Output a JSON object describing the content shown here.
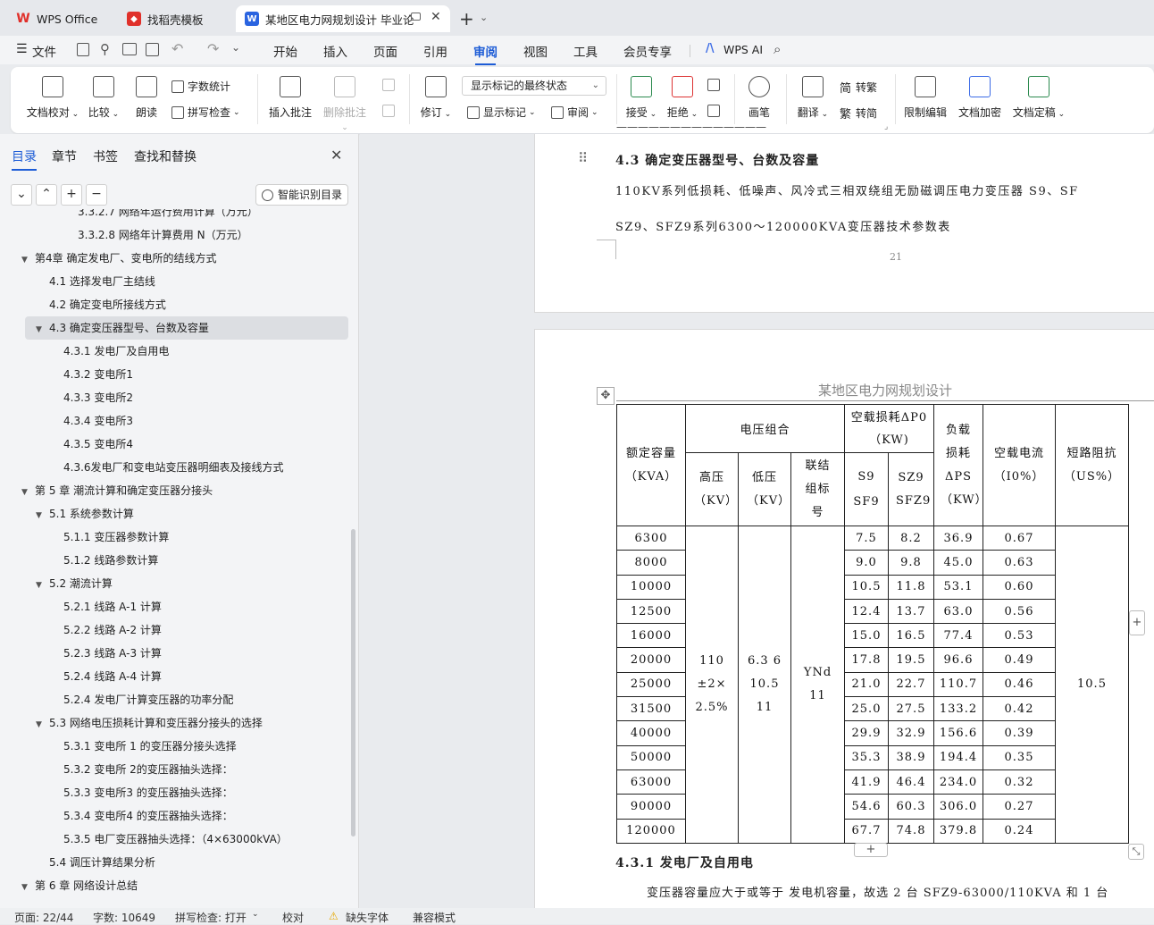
{
  "tabs": [
    {
      "label": "WPS Office",
      "icon": "wps-logo-icon"
    },
    {
      "label": "找稻壳模板",
      "icon": "docer-icon"
    },
    {
      "label": "某地区电力网规划设计 毕业论",
      "icon": "word-doc-icon"
    }
  ],
  "menubar": {
    "file": "文件",
    "items": [
      "开始",
      "插入",
      "页面",
      "引用",
      "审阅",
      "视图",
      "工具",
      "会员专享"
    ],
    "active": "审阅",
    "ai": "WPS AI"
  },
  "ribbon": {
    "doc_check": "文档校对",
    "compare": "比较",
    "read_aloud": "朗读",
    "word_count": "字数统计",
    "spell_check": "拼写检查",
    "insert_comment": "插入批注",
    "delete_comment": "删除批注",
    "revise": "修订",
    "markup_state": "显示标记的最终状态",
    "show_markup": "显示标记",
    "review": "审阅",
    "accept": "接受",
    "reject": "拒绝",
    "pen": "画笔",
    "translate": "翻译",
    "to_traditional": "转繁",
    "to_simplified": "转简",
    "restrict_edit": "限制编辑",
    "encrypt": "文档加密",
    "finalize": "文档定稿"
  },
  "sidebar": {
    "tabs": [
      "目录",
      "章节",
      "书签",
      "查找和替换"
    ],
    "smart_toc": "智能识别目录",
    "items": [
      {
        "text": "3.3.2.7 网络年运行费用计算（万元）",
        "level": 3,
        "arrow": ""
      },
      {
        "text": "3.3.2.8 网络年计算费用 N（万元）",
        "level": 3,
        "arrow": ""
      },
      {
        "text": "第4章  确定发电厂、变电所的结线方式",
        "level": 0,
        "arrow": "▼"
      },
      {
        "text": "4.1  选择发电厂主结线",
        "level": 1,
        "arrow": ""
      },
      {
        "text": "4.2  确定变电所接线方式",
        "level": 1,
        "arrow": ""
      },
      {
        "text": "4.3  确定变压器型号、台数及容量",
        "level": 1,
        "arrow": "▼",
        "selected": true
      },
      {
        "text": "4.3.1  发电厂及自用电",
        "level": 2,
        "arrow": ""
      },
      {
        "text": "4.3.2  变电所1",
        "level": 2,
        "arrow": ""
      },
      {
        "text": "4.3.3  变电所2",
        "level": 2,
        "arrow": ""
      },
      {
        "text": "4.3.4  变电所3",
        "level": 2,
        "arrow": ""
      },
      {
        "text": "4.3.5  变电所4",
        "level": 2,
        "arrow": ""
      },
      {
        "text": "4.3.6发电厂和变电站变压器明细表及接线方式",
        "level": 2,
        "arrow": ""
      },
      {
        "text": "第 5 章  潮流计算和确定变压器分接头",
        "level": 0,
        "arrow": "▼"
      },
      {
        "text": "5.1  系统参数计算",
        "level": 1,
        "arrow": "▼"
      },
      {
        "text": "5.1.1 变压器参数计算",
        "level": 2,
        "arrow": ""
      },
      {
        "text": "5.1.2  线路参数计算",
        "level": 2,
        "arrow": ""
      },
      {
        "text": "5.2  潮流计算",
        "level": 1,
        "arrow": "▼"
      },
      {
        "text": "5.2.1  线路 A-1 计算",
        "level": 2,
        "arrow": ""
      },
      {
        "text": "5.2.2 线路  A-2  计算",
        "level": 2,
        "arrow": ""
      },
      {
        "text": "5.2.3 线路  A-3  计算",
        "level": 2,
        "arrow": ""
      },
      {
        "text": "5.2.4 线路  A-4  计算",
        "level": 2,
        "arrow": ""
      },
      {
        "text": "5.2.4  发电厂计算变压器的功率分配",
        "level": 2,
        "arrow": ""
      },
      {
        "text": "5.3  网络电压损耗计算和变压器分接头的选择",
        "level": 1,
        "arrow": "▼"
      },
      {
        "text": "5.3.1  变电所 1 的变压器分接头选择",
        "level": 2,
        "arrow": ""
      },
      {
        "text": "5.3.2  变电所  2的变压器抽头选择：",
        "level": 2,
        "arrow": ""
      },
      {
        "text": "5.3.3  变电所3  的变压器抽头选择：",
        "level": 2,
        "arrow": ""
      },
      {
        "text": "5.3.4  变电所4  的变压器抽头选择：",
        "level": 2,
        "arrow": ""
      },
      {
        "text": "5.3.5  电厂变压器抽头选择：（4×63000kVA）",
        "level": 2,
        "arrow": ""
      },
      {
        "text": "5.4  调压计算结果分析",
        "level": 1,
        "arrow": ""
      },
      {
        "text": "第 6 章  网络设计总结",
        "level": 0,
        "arrow": "▼"
      }
    ]
  },
  "document": {
    "heading_43": "4.3  确定变压器型号、台数及容量",
    "para_1": "110KV系列低损耗、低噪声、风冷式三相双绕组无励磁调压电力变压器   S9、SF",
    "para_2": "SZ9、SFZ9系列6300～120000KVA变压器技术参数表",
    "page_number": "21",
    "page_header": "某地区电力网规划设计",
    "heading_431": "4.3.1  发电厂及自用电",
    "para_3": "变压器容量应大于或等于  发电机容量，故选 2 台 SFZ9-63000/110KVA 和 1 台"
  },
  "table": {
    "h_rated": "额定容量（KVA）",
    "h_voltage": "电压组合",
    "h_hv": "高压（KV）",
    "h_lv": "低压（KV）",
    "h_group": "联结组标号",
    "h_noload_loss": "空载损耗ΔP0（KW)",
    "h_s9": "S9 SF9",
    "h_sz9": "SZ9 SFZ9",
    "h_load_loss": "负载损耗ΔPS（KW）",
    "h_noload_current": "空载电流（I0%）",
    "h_impedance": "短路阻抗（US%）",
    "hv_value": "110 ±2×2.5%",
    "lv_value": "6.3 6 10.5 11",
    "group_value": "YNd11",
    "impedance_value": "10.5",
    "rows": [
      [
        "6300",
        "7.5",
        "8.2",
        "36.9",
        "0.67"
      ],
      [
        "8000",
        "9.0",
        "9.8",
        "45.0",
        "0.63"
      ],
      [
        "10000",
        "10.5",
        "11.8",
        "53.1",
        "0.60"
      ],
      [
        "12500",
        "12.4",
        "13.7",
        "63.0",
        "0.56"
      ],
      [
        "16000",
        "15.0",
        "16.5",
        "77.4",
        "0.53"
      ],
      [
        "20000",
        "17.8",
        "19.5",
        "96.6",
        "0.49"
      ],
      [
        "25000",
        "21.0",
        "22.7",
        "110.7",
        "0.46"
      ],
      [
        "31500",
        "25.0",
        "27.5",
        "133.2",
        "0.42"
      ],
      [
        "40000",
        "29.9",
        "32.9",
        "156.6",
        "0.39"
      ],
      [
        "50000",
        "35.3",
        "38.9",
        "194.4",
        "0.35"
      ],
      [
        "63000",
        "41.9",
        "46.4",
        "234.0",
        "0.32"
      ],
      [
        "90000",
        "54.6",
        "60.3",
        "306.0",
        "0.27"
      ],
      [
        "120000",
        "67.7",
        "74.8",
        "379.8",
        "0.24"
      ]
    ]
  },
  "statusbar": {
    "page": "页面: 22/44",
    "words": "字数: 10649",
    "spell": "拼写检查: 打开",
    "proof": "校对",
    "missing_font": "缺失字体",
    "compat": "兼容模式"
  }
}
